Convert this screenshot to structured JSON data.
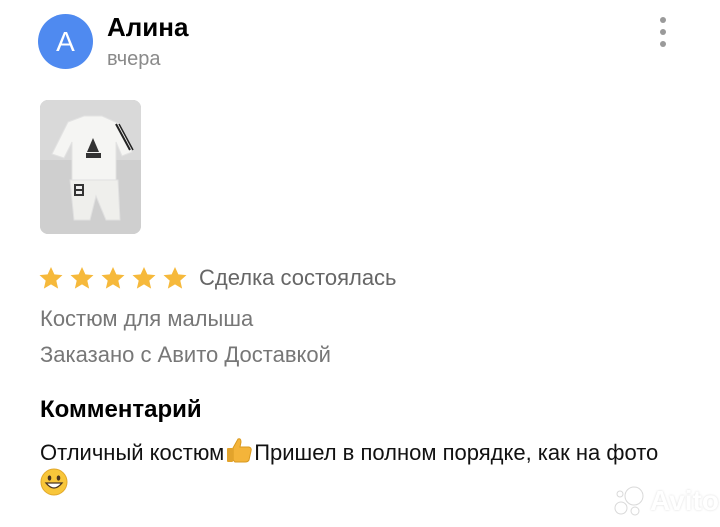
{
  "review": {
    "avatar_letter": "А",
    "author": "Алина",
    "date": "вчера",
    "rating": 5,
    "rating_max": 5,
    "status": "Сделка состоялась",
    "item": "Костюм для малыша",
    "delivery": "Заказано с Авито Доставкой",
    "comment_title": "Комментарий",
    "comment_part1": "Отличный  костюм",
    "comment_part2": "Пришел в полном порядке, как на фото",
    "emoji_1": "thumbs-up",
    "emoji_2": "grinning-face"
  },
  "watermark": {
    "text": "Avito"
  },
  "colors": {
    "avatar": "#4f8af0",
    "star": "#f6b93b",
    "secondary_text": "#777777"
  }
}
